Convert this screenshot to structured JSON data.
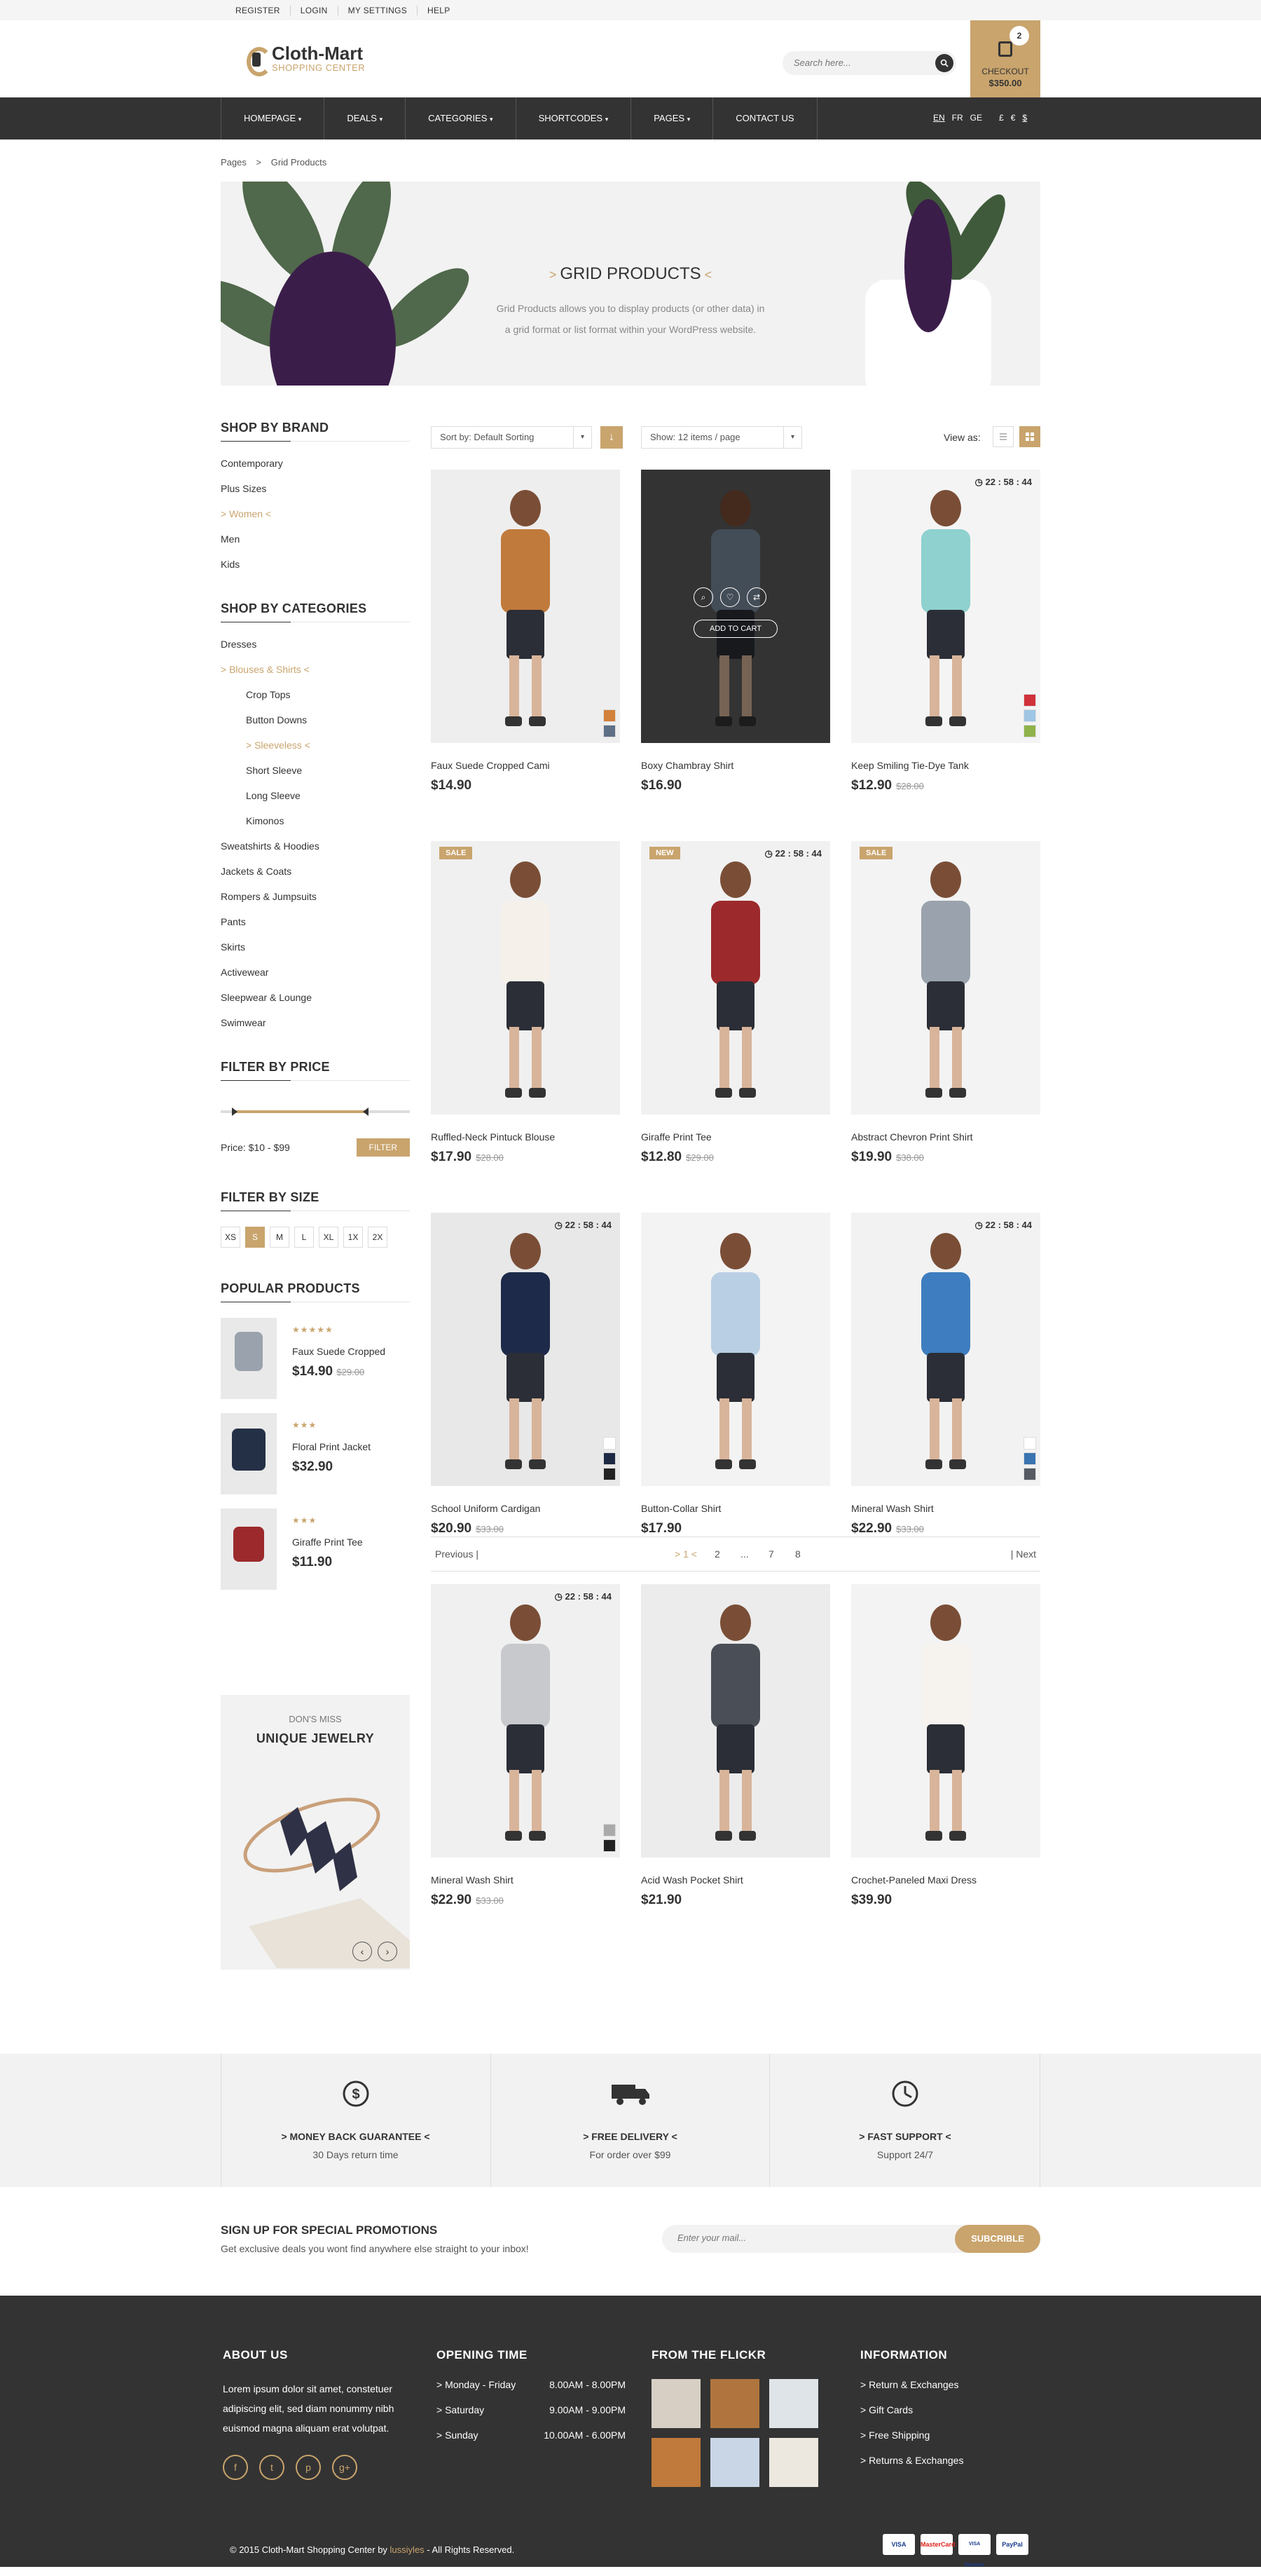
{
  "topbar": {
    "links": [
      "REGISTER",
      "LOGIN",
      "MY SETTINGS",
      "HELP"
    ]
  },
  "logo": {
    "name": "Cloth-Mart",
    "tagline": "SHOPPING CENTER"
  },
  "search": {
    "placeholder": "Search here..."
  },
  "cart": {
    "count": "2",
    "label": "CHECKOUT",
    "total": "$350.00"
  },
  "nav": {
    "items": [
      "HOMEPAGE",
      "DEALS",
      "CATEGORIES",
      "SHORTCODES",
      "PAGES",
      "CONTACT US"
    ],
    "caret": "▾",
    "lang": [
      "EN",
      "FR",
      "GE"
    ],
    "currency": [
      "£",
      "€",
      "$"
    ]
  },
  "breadcrumb": {
    "home": "Pages",
    "sep": ">",
    "current": "Grid Products"
  },
  "banner": {
    "title": "GRID PRODUCTS",
    "line1": "Grid Products allows you to display products (or other data) in",
    "line2": "a grid format or list format within your WordPress website."
  },
  "sidebar": {
    "brand_title": "SHOP BY BRAND",
    "brands": [
      "Contemporary",
      "Plus Sizes",
      "> Women <",
      "Men",
      "Kids"
    ],
    "cat_title": "SHOP BY CATEGORIES",
    "categories": [
      {
        "label": "Dresses",
        "sub": false,
        "active": false
      },
      {
        "label": "> Blouses & Shirts <",
        "sub": false,
        "active": true
      },
      {
        "label": "Crop Tops",
        "sub": true,
        "active": false
      },
      {
        "label": "Button Downs",
        "sub": true,
        "active": false
      },
      {
        "label": "> Sleeveless <",
        "sub": true,
        "active": true
      },
      {
        "label": "Short Sleeve",
        "sub": true,
        "active": false
      },
      {
        "label": "Long Sleeve",
        "sub": true,
        "active": false
      },
      {
        "label": "Kimonos",
        "sub": true,
        "active": false
      },
      {
        "label": "Sweatshirts & Hoodies",
        "sub": false,
        "active": false
      },
      {
        "label": "Jackets & Coats",
        "sub": false,
        "active": false
      },
      {
        "label": "Rompers & Jumpsuits",
        "sub": false,
        "active": false
      },
      {
        "label": "Pants",
        "sub": false,
        "active": false
      },
      {
        "label": "Skirts",
        "sub": false,
        "active": false
      },
      {
        "label": "Activewear",
        "sub": false,
        "active": false
      },
      {
        "label": "Sleepwear & Lounge",
        "sub": false,
        "active": false
      },
      {
        "label": "Swimwear",
        "sub": false,
        "active": false
      }
    ],
    "price_title": "FILTER BY PRICE",
    "price_label": "Price: $10 - $99",
    "price_range": [
      0.06,
      0.78
    ],
    "filter_btn": "FILTER",
    "size_title": "FILTER BY SIZE",
    "sizes": [
      "XS",
      "S",
      "M",
      "L",
      "XL",
      "1X",
      "2X"
    ],
    "size_selected": "S",
    "popular_title": "POPULAR PRODUCTS",
    "popular": [
      {
        "name": "Faux Suede Cropped",
        "price": "$14.90",
        "old": "$29.00",
        "rating": 4.5,
        "stars": "★★★★★"
      },
      {
        "name": "Floral Print Jacket",
        "price": "$32.90",
        "old": "",
        "rating": 2.5,
        "stars": "★★★"
      },
      {
        "name": "Giraffe Print Tee",
        "price": "$11.90",
        "old": "",
        "rating": 2.5,
        "stars": "★★★"
      }
    ],
    "promo_small": "DON'S MISS",
    "promo_big": "UNIQUE JEWELRY"
  },
  "toolbar": {
    "sort": "Sort by: Default Sorting",
    "show": "Show: 12 items / page",
    "view_as": "View as:"
  },
  "products": [
    {
      "name": "Faux Suede Cropped Cami",
      "price": "$14.90",
      "old": "",
      "badge": "",
      "timer": "",
      "swatches": [
        "#d2813a",
        "#5e6f86"
      ],
      "bg": "#eeeeee",
      "cloth": "#c07a3b",
      "hover": false
    },
    {
      "name": "Boxy Chambray Shirt",
      "price": "$16.90",
      "old": "",
      "badge": "",
      "timer": "",
      "swatches": [],
      "bg": "#5d5d5d",
      "cloth": "#7a8da0",
      "hover": true,
      "add_to_cart": "ADD TO CART"
    },
    {
      "name": "Keep Smiling Tie-Dye Tank",
      "price": "$12.90",
      "old": "$28.00",
      "badge": "",
      "timer": "22 : 58 : 44",
      "swatches": [
        "#d0313a",
        "#9fc6e4",
        "#8fb24a"
      ],
      "bg": "#f4f4f4",
      "cloth": "#8ed1cf",
      "hover": false
    },
    {
      "name": "Ruffled-Neck Pintuck Blouse",
      "price": "$17.90",
      "old": "$28.00",
      "badge": "SALE",
      "timer": "",
      "swatches": [],
      "bg": "#f0f0f0",
      "cloth": "#f5f0ea",
      "hover": false
    },
    {
      "name": "Giraffe Print Tee",
      "price": "$12.80",
      "old": "$29.00",
      "badge": "NEW",
      "timer": "22 : 58 : 44",
      "swatches": [],
      "bg": "#f1f1f1",
      "cloth": "#9c2a2c",
      "hover": false
    },
    {
      "name": "Abstract Chevron Print Shirt",
      "price": "$19.90",
      "old": "$38.00",
      "badge": "SALE",
      "timer": "",
      "swatches": [],
      "bg": "#f3f3f3",
      "cloth": "#9aa3ad",
      "hover": false
    },
    {
      "name": "School Uniform Cardigan",
      "price": "$20.90",
      "old": "$33.00",
      "badge": "",
      "timer": "22 : 58 : 44",
      "swatches": [
        "#ffffff",
        "#1e2a44",
        "#222222"
      ],
      "bg": "#e8e8e8",
      "cloth": "#1d2a4a",
      "hover": false
    },
    {
      "name": "Button-Collar Shirt",
      "price": "$17.90",
      "old": "",
      "badge": "",
      "timer": "",
      "swatches": [],
      "bg": "#f3f3f3",
      "cloth": "#b9cfe4",
      "hover": false
    },
    {
      "name": "Mineral Wash Shirt",
      "price": "$22.90",
      "old": "$33.00",
      "badge": "",
      "timer": "22 : 58 : 44",
      "swatches": [
        "#ffffff",
        "#3a74b0",
        "#555a63"
      ],
      "bg": "#f2f2f2",
      "cloth": "#3e7dbf",
      "hover": false
    },
    {
      "name": "Mineral Wash Shirt",
      "price": "$22.90",
      "old": "$33.00",
      "badge": "",
      "timer": "22 : 58 : 44",
      "swatches": [
        "#aaaaaa",
        "#222222"
      ],
      "bg": "#f0f0f0",
      "cloth": "#c7c9cc",
      "hover": false
    },
    {
      "name": "Acid Wash Pocket Shirt",
      "price": "$21.90",
      "old": "",
      "badge": "",
      "timer": "",
      "swatches": [],
      "bg": "#ececec",
      "cloth": "#4a4f57",
      "hover": false
    },
    {
      "name": "Crochet-Paneled Maxi Dress",
      "price": "$39.90",
      "old": "",
      "badge": "",
      "timer": "",
      "swatches": [],
      "bg": "#f3f3f3",
      "cloth": "#f6f3ee",
      "hover": false
    }
  ],
  "pager": {
    "prev": "Previous |",
    "next": "| Next",
    "pages": [
      "> 1 <",
      "2",
      "...",
      "7",
      "8"
    ]
  },
  "features": [
    {
      "title": "> MONEY BACK GUARANTEE <",
      "sub": "30 Days return time",
      "icon": "dollar-icon"
    },
    {
      "title": "> FREE DELIVERY <",
      "sub": "For order over $99",
      "icon": "truck-icon"
    },
    {
      "title": "> FAST SUPPORT <",
      "sub": "Support 24/7",
      "icon": "clock-icon"
    }
  ],
  "newsletter": {
    "title": "SIGN UP FOR SPECIAL PROMOTIONS",
    "sub": "Get exclusive deals you wont find anywhere else straight to your inbox!",
    "placeholder": "Enter your mail...",
    "button": "SUBCRIBLE"
  },
  "footer": {
    "about_title": "ABOUT US",
    "about_text": "Lorem ipsum dolor sit amet, constetuer adipiscing elit, sed diam nonummy nibh euismod magna aliquam erat volutpat.",
    "social": [
      "f",
      "t",
      "p",
      "g+"
    ],
    "hours_title": "OPENING TIME",
    "hours": [
      {
        "day": "> Monday - Friday",
        "time": "8.00AM - 8.00PM"
      },
      {
        "day": "> Saturday",
        "time": "9.00AM - 9.00PM"
      },
      {
        "day": "> Sunday",
        "time": "10.00AM - 6.00PM"
      }
    ],
    "flickr_title": "FROM THE FLICKR",
    "info_title": "INFORMATION",
    "info": [
      "> Return & Exchanges",
      "> Gift Cards",
      "> Free Shipping",
      "> Returns & Exchanges"
    ],
    "copyright_pre": "© 2015 Cloth-Mart Shopping Center by ",
    "copyright_brand": "lussiyles",
    "copyright_post": " - All Rights Reserved.",
    "payments": [
      "VISA",
      "MasterCard",
      "VISA Electron",
      "PayPal"
    ]
  },
  "colors": {
    "accent": "#c9a46d",
    "dark": "#333333"
  }
}
